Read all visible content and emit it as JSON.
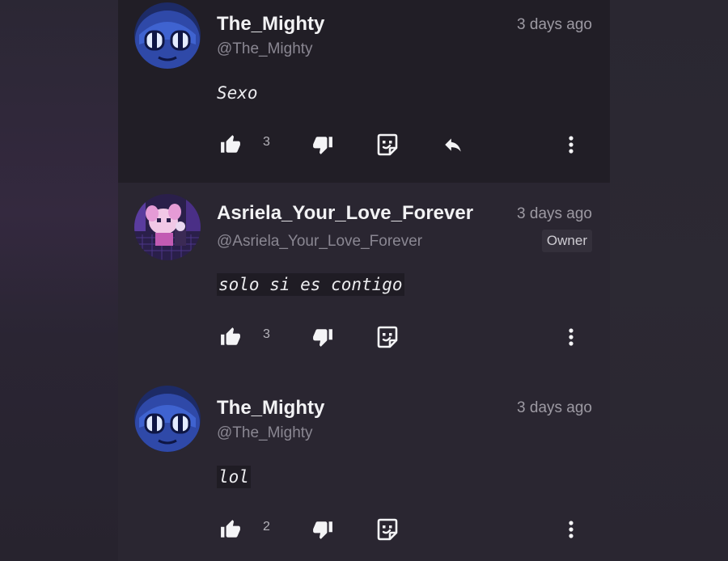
{
  "comments": [
    {
      "username": "The_Mighty",
      "handle": "@The_Mighty",
      "time": "3 days ago",
      "text": "Sexo",
      "likes": "3",
      "badge": "",
      "avatar_icon": "blue-mask-avatar"
    },
    {
      "username": "Asriela_Your_Love_Forever",
      "handle": "@Asriela_Your_Love_Forever",
      "time": "3 days ago",
      "text": "solo si es contigo",
      "likes": "3",
      "badge": "Owner",
      "avatar_icon": "pixel-character-avatar"
    },
    {
      "username": "The_Mighty",
      "handle": "@The_Mighty",
      "time": "3 days ago",
      "text": "lol",
      "likes": "2",
      "badge": "",
      "avatar_icon": "blue-mask-avatar"
    }
  ],
  "icons": {
    "like": "thumbs-up-icon",
    "dislike": "thumbs-down-icon",
    "sticker": "sticker-icon",
    "reply": "reply-icon",
    "more": "more-vertical-icon"
  },
  "colors": {
    "background": "#262330",
    "highlight": "#211e26",
    "text": "#f2f2f4",
    "muted": "#8a8792"
  }
}
